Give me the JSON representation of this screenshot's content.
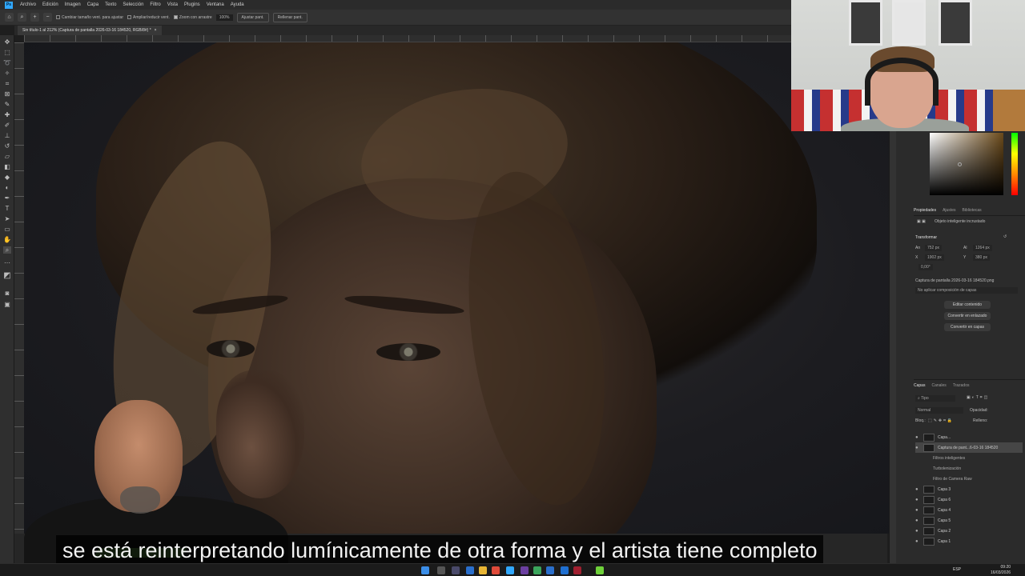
{
  "menubar": {
    "app_badge": "Ps",
    "items": [
      "Archivo",
      "Edición",
      "Imagen",
      "Capa",
      "Texto",
      "Selección",
      "Filtro",
      "Vista",
      "Plugins",
      "Ventana",
      "Ayuda"
    ]
  },
  "options_bar": {
    "resize_windows_label": "Cambiar tamaño vent. para ajustar",
    "zoom_all_windows_label": "Ampliar/reducir vent.",
    "scrubby_zoom_label": "Zoom con arrastre",
    "zoom_value": "100%",
    "fit_screen_button": "Ajustar pant.",
    "fill_screen_button": "Rellenar pant."
  },
  "document": {
    "tab_title": "Sin título-1 al 212% (Captura de pantalla 2026-03-16 184520, RGB/8#) *",
    "close_glyph": "×"
  },
  "properties_panel": {
    "tabs": [
      "Propiedades",
      "Ajustes",
      "Bibliotecas"
    ],
    "object_type": "Objeto inteligente incrustado",
    "transform_heading": "Transformar",
    "w_label": "An",
    "w_value": "752 px",
    "h_label": "Al",
    "h_value": "1264 px",
    "x_label": "X",
    "x_value": "1902 px",
    "y_label": "Y",
    "y_value": "380 px",
    "angle_value": "0,00°",
    "linked_file": "Captura de pantalla 2026-03-16 184520.png",
    "comp_placeholder": "No aplicar composición de capas",
    "buttons": [
      "Editar contenido",
      "Convertir en enlazado",
      "Convertir en capas"
    ]
  },
  "layers_panel": {
    "tabs": [
      "Capas",
      "Canales",
      "Trazados"
    ],
    "filter_kind": "Tipo",
    "blend_mode": "Normal",
    "opacity_label": "Opacidad:",
    "lock_label": "Bloq.:",
    "fill_label": "Relleno:",
    "layers": [
      {
        "name": "Capa...",
        "selected": false,
        "sub": false
      },
      {
        "name": "Captura de pant...6-03-16 184520",
        "selected": true,
        "sub": false
      },
      {
        "name": "Filtros inteligentes",
        "selected": false,
        "sub": true
      },
      {
        "name": "Turbolenización",
        "selected": false,
        "sub": true
      },
      {
        "name": "Filtro de Camera Raw",
        "selected": false,
        "sub": true
      },
      {
        "name": "Capa 3",
        "selected": false,
        "sub": false
      },
      {
        "name": "Capa 6",
        "selected": false,
        "sub": false
      },
      {
        "name": "Capa 4",
        "selected": false,
        "sub": false
      },
      {
        "name": "Capa 5",
        "selected": false,
        "sub": false
      },
      {
        "name": "Capa 2",
        "selected": false,
        "sub": false
      },
      {
        "name": "Capa 1",
        "selected": false,
        "sub": false
      }
    ]
  },
  "subtitle": "se está reinterpretando lumínicamente de otra forma y el artista tiene completo",
  "taskbar": {
    "language": "ESP",
    "time": "09:20",
    "date": "16/03/2026"
  },
  "colors": {
    "accent": "#31a8ff",
    "panel_bg": "#2b2b2b",
    "canvas_bg": "#1c1c20"
  }
}
